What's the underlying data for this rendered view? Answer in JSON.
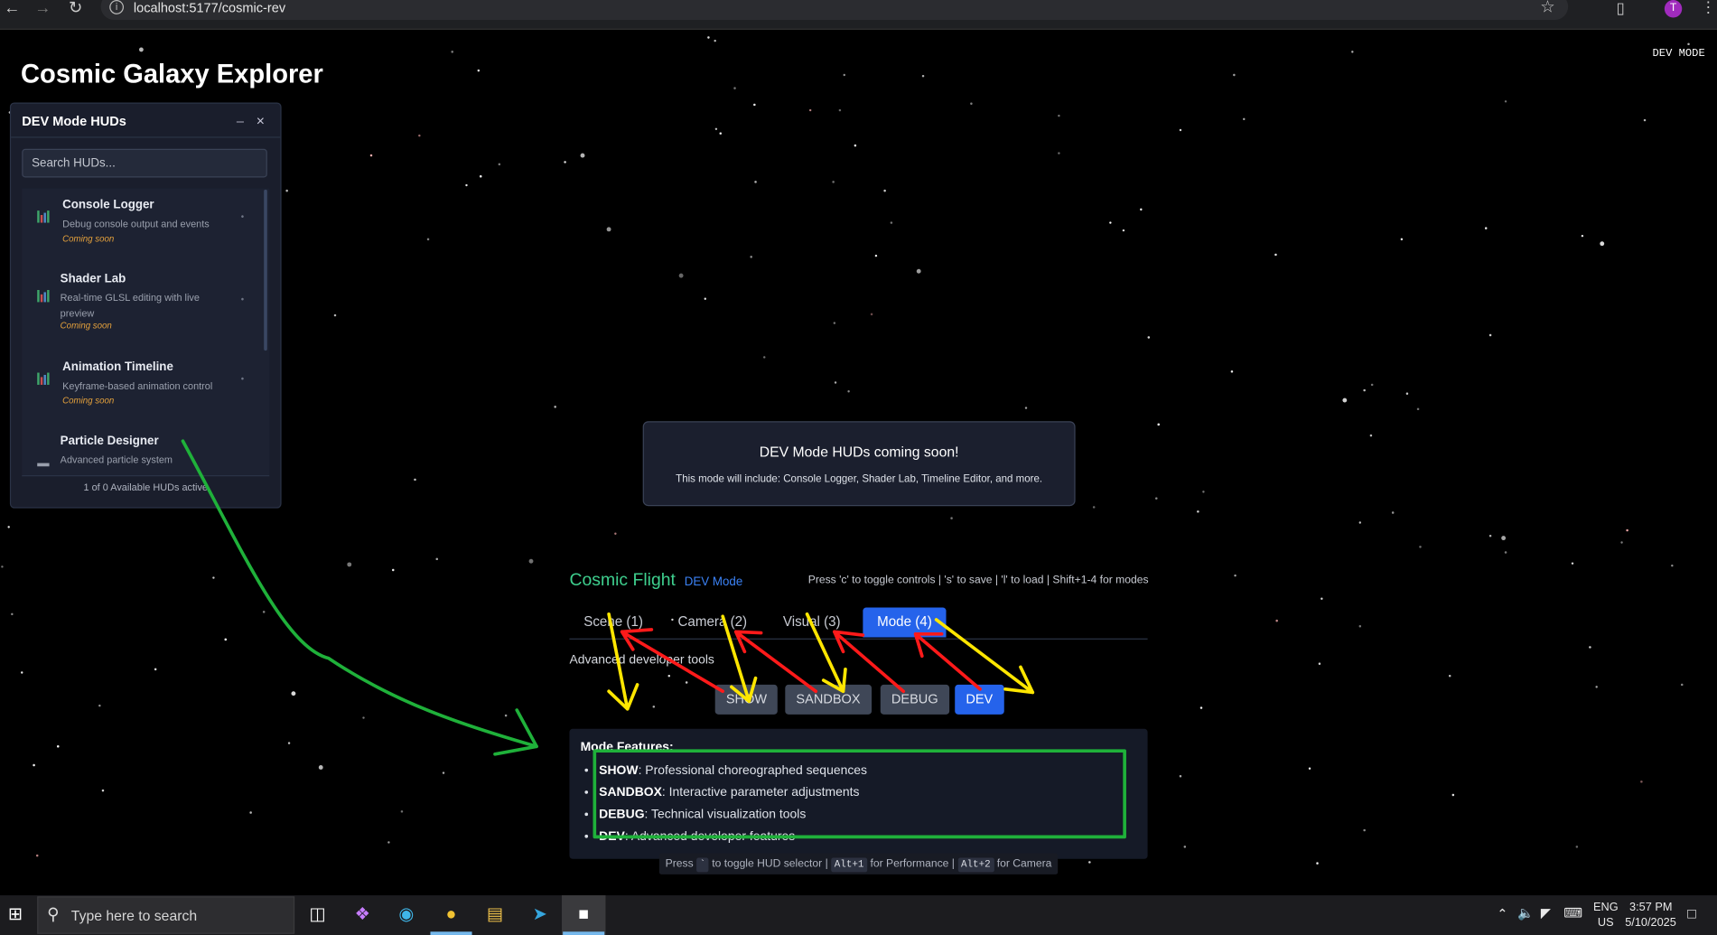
{
  "browser": {
    "url": "localhost:5177/cosmic-rev",
    "profile_initial": "T"
  },
  "app": {
    "title": "Cosmic Galaxy Explorer",
    "mode_indicator": "DEV MODE"
  },
  "hud_panel": {
    "title": "DEV Mode HUDs",
    "minimize": "–",
    "close": "×",
    "search_placeholder": "Search HUDs...",
    "items": [
      {
        "name": "Console Logger",
        "description": "Debug console output and events",
        "status": "Coming soon"
      },
      {
        "name": "Shader Lab",
        "description": "Real-time GLSL editing with live preview",
        "status": "Coming soon"
      },
      {
        "name": "Animation Timeline",
        "description": "Keyframe-based animation control",
        "status": "Coming soon"
      },
      {
        "name": "Particle Designer",
        "description": "Advanced particle system",
        "status": ""
      }
    ],
    "footer": "1 of 0 Available HUDs active"
  },
  "notice": {
    "title": "DEV Mode HUDs coming soon!",
    "body": "This mode will include: Console Logger, Shader Lab, Timeline Editor, and more."
  },
  "control_panel": {
    "title": "Cosmic Flight",
    "mode_label": "DEV Mode",
    "help": "Press 'c' to toggle controls | 's' to save | 'l' to load | Shift+1-4 for modes",
    "tabs": [
      {
        "label": "Scene (1)",
        "active": false
      },
      {
        "label": "Camera (2)",
        "active": false
      },
      {
        "label": "Visual (3)",
        "active": false
      },
      {
        "label": "Mode (4)",
        "active": true
      }
    ],
    "tab_description": "Advanced developer tools",
    "mode_buttons": [
      {
        "label": "SHOW",
        "active": false
      },
      {
        "label": "SANDBOX",
        "active": false
      },
      {
        "label": "DEBUG",
        "active": false
      },
      {
        "label": "DEV",
        "active": true
      }
    ],
    "features_title": "Mode Features:",
    "features": [
      {
        "name": "SHOW",
        "text": ": Professional choreographed sequences"
      },
      {
        "name": "SANDBOX",
        "text": ": Interactive parameter adjustments"
      },
      {
        "name": "DEBUG",
        "text": ": Technical visualization tools"
      },
      {
        "name": "DEV",
        "text": ": Advanced developer features"
      }
    ],
    "hint": {
      "press": "Press",
      "key1": "`",
      "t1": "to toggle HUD selector |",
      "key2": "Alt+1",
      "t2": "for Performance |",
      "key3": "Alt+2",
      "t3": "for Camera"
    }
  },
  "taskbar": {
    "search_placeholder": "Type here to search",
    "language": "ENG",
    "region": "US",
    "time": "3:57 PM",
    "date": "5/10/2025"
  },
  "colors": {
    "accent_blue": "#2563eb",
    "title_green": "#3ecf8e",
    "coming_soon": "#e6a23c",
    "annotation_red": "#ff1a1a",
    "annotation_yellow": "#ffe600",
    "annotation_green": "#1fb13a"
  },
  "icons": [
    "back-arrow-icon",
    "forward-arrow-icon",
    "reload-icon",
    "info-icon",
    "star-icon",
    "extensions-icon",
    "kebab-menu-icon",
    "chart-icon",
    "windows-start-icon",
    "search-icon",
    "task-view-icon",
    "edge-icon",
    "chrome-icon",
    "file-explorer-icon",
    "telegram-icon",
    "app-icon",
    "notification-icon"
  ]
}
